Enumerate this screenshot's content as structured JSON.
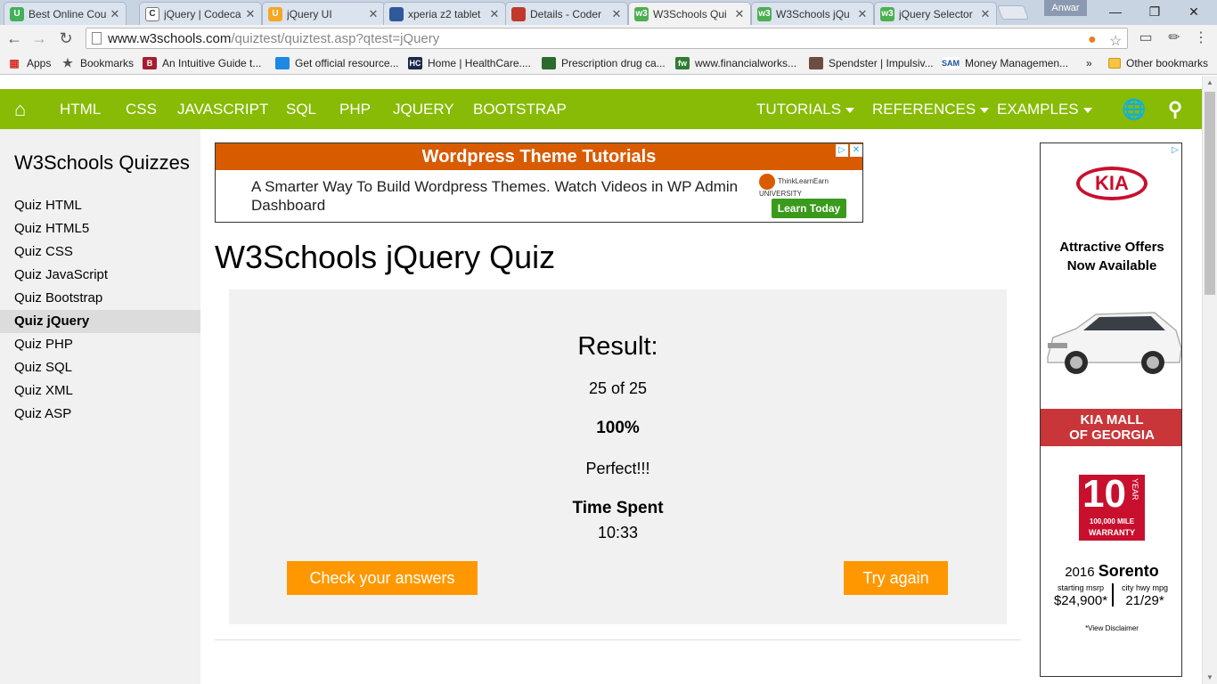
{
  "browser": {
    "tabs": [
      {
        "title": "Best Online Cou",
        "favicon": "udemy-icon",
        "color": "#44b05a",
        "glyph": "U"
      },
      {
        "title": "jQuery | Codeca",
        "favicon": "codecademy-icon",
        "color": "#ffffff",
        "glyph": "C"
      },
      {
        "title": "jQuery UI",
        "favicon": "udemy-icon",
        "color": "#f5a623",
        "glyph": "U"
      },
      {
        "title": "xperia z2 tablet",
        "favicon": "amazon-icon",
        "color": "#2e5a9c",
        "glyph": ""
      },
      {
        "title": "Details - Coder",
        "favicon": "gear-icon",
        "color": "#c0392b",
        "glyph": ""
      },
      {
        "title": "W3Schools Qui",
        "favicon": "w3schools-icon",
        "color": "#4caf50",
        "glyph": "w3"
      },
      {
        "title": "W3Schools jQu",
        "favicon": "w3schools-icon",
        "color": "#4caf50",
        "glyph": "w3"
      },
      {
        "title": "jQuery Selector",
        "favicon": "w3schools-icon",
        "color": "#4caf50",
        "glyph": "w3"
      }
    ],
    "active_tab": 5,
    "profile_name": "Anwar",
    "url_host": "www.w3schools.com",
    "url_path": "/quiztest/quiztest.asp?qtest=jQuery"
  },
  "bookmarks": {
    "apps_label": "Apps",
    "bookmarks_label": "Bookmarks",
    "items": [
      {
        "label": "An Intuitive Guide t...",
        "color": "#a51c30",
        "glyph": "B"
      },
      {
        "label": "Get official resource...",
        "color": "#1e88e5",
        "glyph": ""
      },
      {
        "label": "Home | HealthCare....",
        "color": "#1a2a4a",
        "glyph": "HC"
      },
      {
        "label": "Prescription drug ca...",
        "color": "#2d6a2d",
        "glyph": ""
      },
      {
        "label": "www.financialworks...",
        "color": "#2e7d32",
        "glyph": "fw"
      },
      {
        "label": "Spendster | Impulsiv...",
        "color": "#6d4c41",
        "glyph": ""
      },
      {
        "label": "Money Managemen...",
        "color": "#ffffff",
        "glyph": "SAM"
      }
    ],
    "more_label": "»",
    "other_label": "Other bookmarks"
  },
  "topnav": {
    "left_items": [
      "HTML",
      "CSS",
      "JAVASCRIPT",
      "SQL",
      "PHP",
      "JQUERY",
      "BOOTSTRAP"
    ],
    "right_items": [
      "TUTORIALS",
      "REFERENCES",
      "EXAMPLES"
    ],
    "bar_color": "#87bb05"
  },
  "sidebar": {
    "heading": "W3Schools Quizzes",
    "links": [
      "Quiz HTML",
      "Quiz HTML5",
      "Quiz CSS",
      "Quiz JavaScript",
      "Quiz Bootstrap",
      "Quiz jQuery",
      "Quiz PHP",
      "Quiz SQL",
      "Quiz XML",
      "Quiz ASP"
    ],
    "active_index": 5
  },
  "ad_top": {
    "headline": "Wordpress Theme Tutorials",
    "body": "A Smarter Way To Build Wordpress Themes. Watch Videos in WP Admin Dashboard",
    "logo_text": "ThinkLearnEarn UNIVERSITY",
    "cta": "Learn Today"
  },
  "main": {
    "title": "W3Schools jQuery Quiz",
    "result_heading": "Result:",
    "score": "25 of 25",
    "percent": "100%",
    "verdict": "Perfect!!!",
    "time_label": "Time Spent",
    "time_value": "10:33",
    "check_button": "Check your answers",
    "retry_button": "Try again",
    "button_color": "#ff9800"
  },
  "ad_right": {
    "brand": "KIA",
    "offer": "Attractive Offers Now Available",
    "dealer_line1": "KIA MALL",
    "dealer_line2": "OF GEORGIA",
    "warranty_years": "10",
    "warranty_word": "YEAR",
    "warranty_miles": "100,000 MILE",
    "warranty_label": "WARRANTY",
    "model_year": "2016",
    "model_name": "Sorento",
    "msrp_label": "starting msrp",
    "msrp_value": "$24,900*",
    "mpg_label": "city hwy mpg",
    "mpg_value": "21/29*",
    "disclaimer": "*View Disclaimer"
  }
}
